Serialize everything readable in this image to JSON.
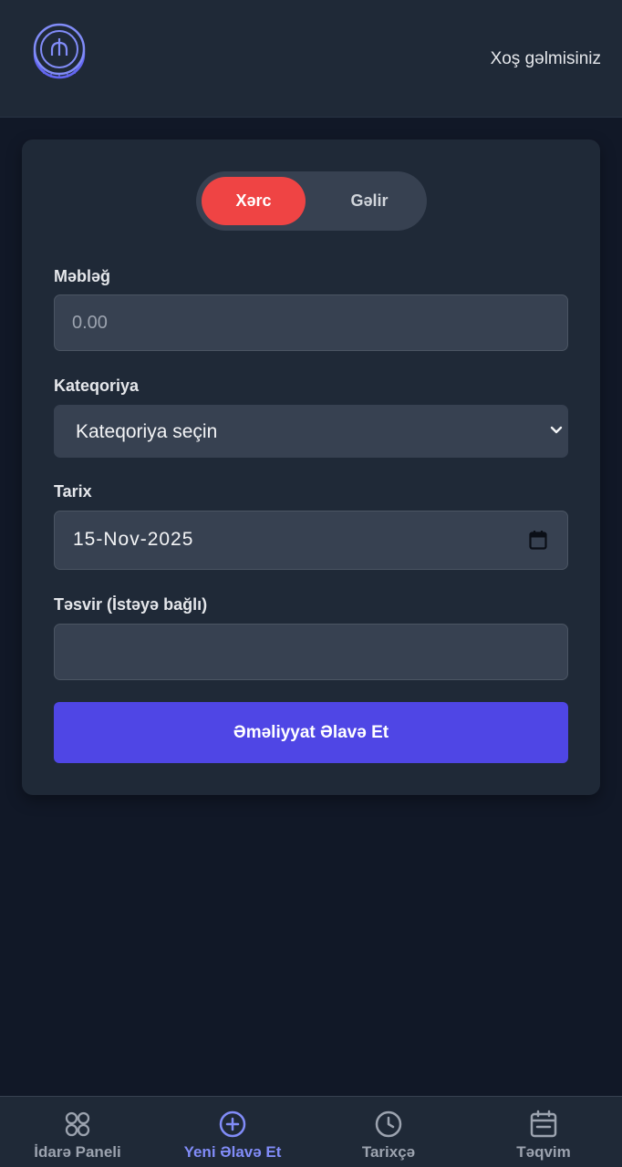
{
  "header": {
    "logo_icon": "coin-icon",
    "welcome_text": "Xoş gəlmisiniz"
  },
  "form": {
    "type_toggle": {
      "options": [
        "Xərc",
        "Gəlir"
      ],
      "selected": "Xərc",
      "selected_color": "#ef4444"
    },
    "amount": {
      "label": "Məbləğ",
      "value": "",
      "placeholder": "0.00"
    },
    "category": {
      "label": "Kateqoriya",
      "selected": "Kateqoriya seçin",
      "icon": "chevron-down-icon"
    },
    "date": {
      "label": "Tarix",
      "value": "15-Nov-2025",
      "icon": "calendar-icon"
    },
    "description": {
      "label": "Təsvir (İstəyə bağlı)",
      "value": "",
      "placeholder": ""
    },
    "submit_label": "Əməliyyat Əlavə Et",
    "submit_color": "#4f46e5"
  },
  "bottom_nav": {
    "items": [
      {
        "label": "İdarə Paneli",
        "icon": "dashboard-grid-icon",
        "active": false
      },
      {
        "label": "Yeni Əlavə Et",
        "icon": "plus-circle-icon",
        "active": true
      },
      {
        "label": "Tarixçə",
        "icon": "clock-icon",
        "active": false
      },
      {
        "label": "Təqvim",
        "icon": "calendar-icon",
        "active": false
      }
    ],
    "active_color": "#818cf8"
  }
}
